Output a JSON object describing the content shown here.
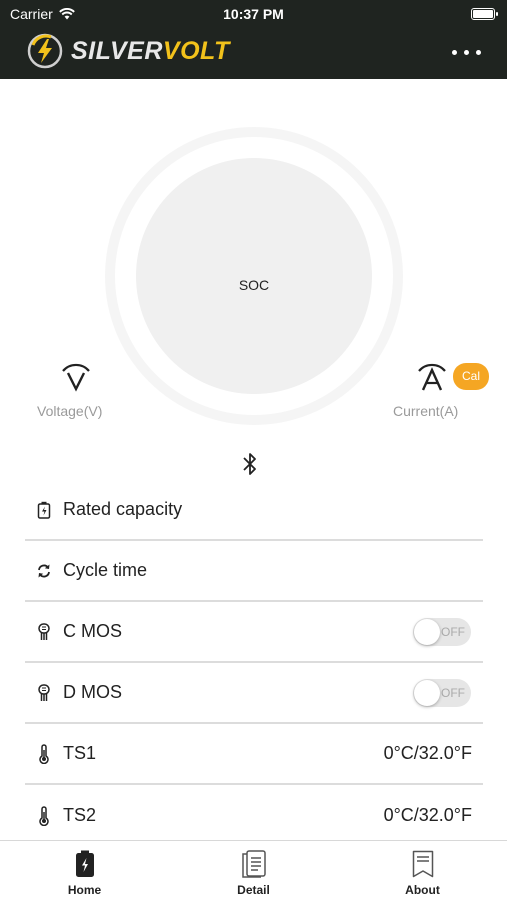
{
  "status_bar": {
    "carrier": "Carrier",
    "time": "10:37 PM",
    "battery_level": 1.0
  },
  "header": {
    "brand_part1": "SILVER",
    "brand_part2": "VOLT",
    "brand_colors": {
      "silver": "#e8e8e8",
      "volt": "#f2c21b",
      "background": "#1f2420"
    },
    "menu_icon": "more-dots-icon"
  },
  "gauge": {
    "soc_label": "SOC"
  },
  "voltage": {
    "icon": "voltage-icon",
    "label": "Voltage(V)"
  },
  "current": {
    "icon": "current-icon",
    "label": "Current(A)",
    "cal_label": "Cal",
    "cal_color": "#f5a623"
  },
  "bluetooth": {
    "icon": "bluetooth-icon"
  },
  "rows": [
    {
      "icon": "battery-charge-icon",
      "label": "Rated capacity",
      "value": ""
    },
    {
      "icon": "refresh-icon",
      "label": "Cycle time",
      "value": ""
    },
    {
      "icon": "mosfet-icon",
      "label": "C MOS",
      "toggle_text": "OFF",
      "toggle_on": false
    },
    {
      "icon": "mosfet-icon",
      "label": "D MOS",
      "toggle_text": "OFF",
      "toggle_on": false
    },
    {
      "icon": "thermometer-icon",
      "label": "TS1",
      "value": "0°C/32.0°F"
    },
    {
      "icon": "thermometer-icon",
      "label": "TS2",
      "value": "0°C/32.0°F"
    }
  ],
  "tabs": [
    {
      "icon": "battery-tab-icon",
      "label": "Home",
      "active": true
    },
    {
      "icon": "detail-list-icon",
      "label": "Detail",
      "active": false
    },
    {
      "icon": "bookmark-about-icon",
      "label": "About",
      "active": false
    }
  ]
}
